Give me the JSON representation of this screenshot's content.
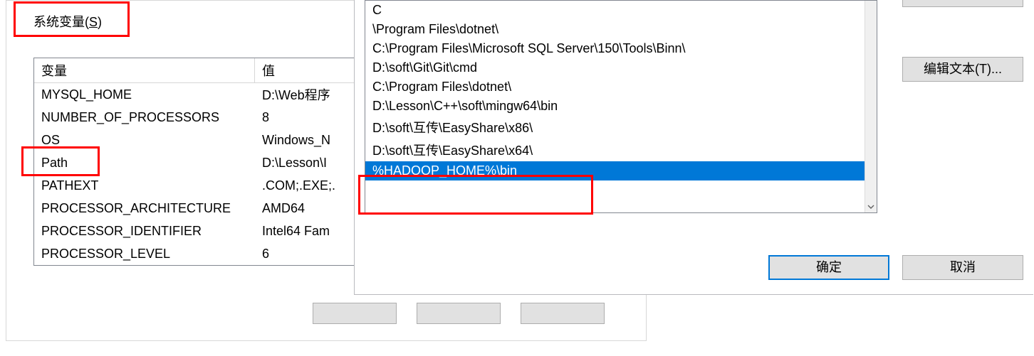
{
  "group_label": {
    "prefix": "系统变量(",
    "accel": "S",
    "suffix": ")"
  },
  "columns": {
    "name": "变量",
    "value": "值"
  },
  "vars": [
    {
      "name": "MYSQL_HOME",
      "value": "D:\\Web程序"
    },
    {
      "name": "NUMBER_OF_PROCESSORS",
      "value": "8"
    },
    {
      "name": "OS",
      "value": "Windows_N"
    },
    {
      "name": "Path",
      "value": "D:\\Lesson\\I"
    },
    {
      "name": "PATHEXT",
      "value": ".COM;.EXE;."
    },
    {
      "name": "PROCESSOR_ARCHITECTURE",
      "value": "AMD64"
    },
    {
      "name": "PROCESSOR_IDENTIFIER",
      "value": "Intel64 Fam"
    },
    {
      "name": "PROCESSOR_LEVEL",
      "value": "6"
    }
  ],
  "path_items": [
    {
      "text": "C",
      "selected": false
    },
    {
      "text": "\\Program Files\\dotnet\\",
      "selected": false
    },
    {
      "text": "C:\\Program Files\\Microsoft SQL Server\\150\\Tools\\Binn\\",
      "selected": false
    },
    {
      "text": "D:\\soft\\Git\\Git\\cmd",
      "selected": false
    },
    {
      "text": "C:\\Program Files\\dotnet\\",
      "selected": false
    },
    {
      "text": "D:\\Lesson\\C++\\soft\\mingw64\\bin",
      "selected": false
    },
    {
      "text": "D:\\soft\\互传\\EasyShare\\x86\\",
      "selected": false
    },
    {
      "text": "D:\\soft\\互传\\EasyShare\\x64\\",
      "selected": false
    },
    {
      "text": "%HADOOP_HOME%\\bin",
      "selected": true
    }
  ],
  "buttons": {
    "edit_text": "编辑文本(T)...",
    "ok": "确定",
    "cancel": "取消"
  }
}
